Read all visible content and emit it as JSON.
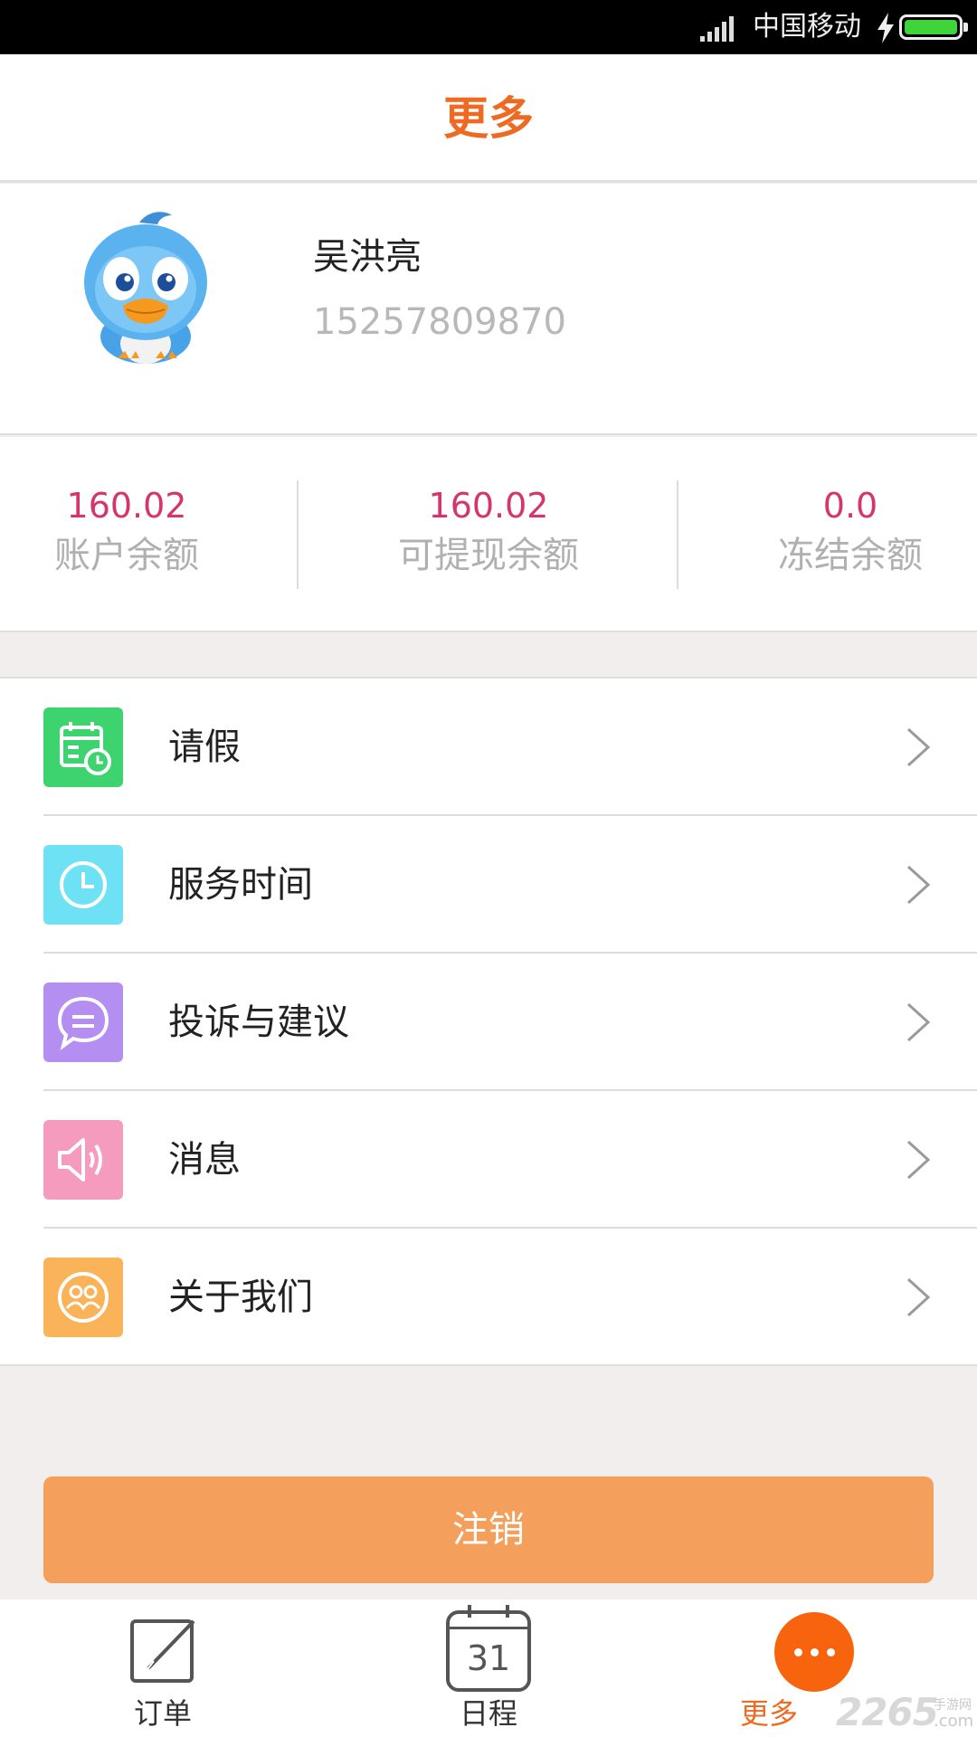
{
  "status_bar": {
    "carrier": "中国移动"
  },
  "header": {
    "title": "更多"
  },
  "profile": {
    "name": "吴洪亮",
    "phone": "15257809870"
  },
  "balances": [
    {
      "value": "160.02",
      "label": "账户余额"
    },
    {
      "value": "160.02",
      "label": "可提现余额"
    },
    {
      "value": "0.0",
      "label": "冻结余额"
    }
  ],
  "menu": [
    {
      "label": "请假",
      "icon": "calendar-clock-icon",
      "color": "#3dd46f"
    },
    {
      "label": "服务时间",
      "icon": "clock-icon",
      "color": "#6ee2f4"
    },
    {
      "label": "投诉与建议",
      "icon": "chat-bubble-icon",
      "color": "#b48ef0"
    },
    {
      "label": "消息",
      "icon": "speaker-icon",
      "color": "#f59bbd"
    },
    {
      "label": "关于我们",
      "icon": "people-icon",
      "color": "#fbb35a"
    }
  ],
  "logout_label": "注销",
  "tabs": [
    {
      "label": "订单",
      "icon": "edit-icon",
      "active": false
    },
    {
      "label": "日程",
      "icon": "calendar-icon",
      "calendar_day": "31",
      "active": false
    },
    {
      "label": "更多",
      "icon": "more-dots-icon",
      "active": true
    }
  ],
  "watermark": {
    "number": "2265",
    "suffix": "手游网",
    "domain": ".com"
  },
  "colors": {
    "accent": "#ee6a22",
    "balance_value": "#d6356a",
    "logout_bg": "#f49f5c"
  }
}
